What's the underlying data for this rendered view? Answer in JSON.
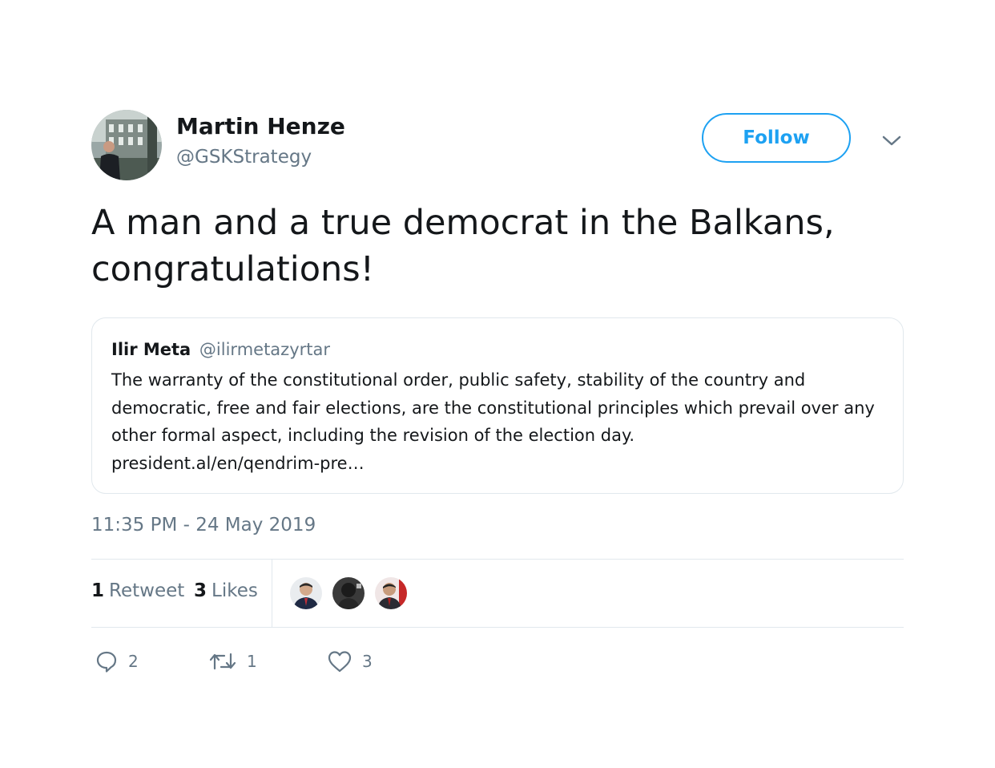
{
  "tweet": {
    "author_name": "Martin Henze",
    "author_handle": "@GSKStrategy",
    "follow_label": "Follow",
    "text": "A man and a true democrat in the Balkans, congratulations!",
    "timestamp": "11:35 PM - 24 May 2019"
  },
  "quoted": {
    "name": "Ilir Meta",
    "handle": "@ilirmetazyrtar",
    "body": "The warranty of the constitutional order, public safety, stability of the country and democratic, free and fair elections, are the constitutional principles which prevail over any other formal aspect, including the revision of the election day.",
    "link": "president.al/en/qendrim-pre…"
  },
  "stats": {
    "retweets_count": "1",
    "retweets_label": "Retweet",
    "likes_count": "3",
    "likes_label": "Likes"
  },
  "actions": {
    "reply_count": "2",
    "retweet_count": "1",
    "like_count": "3"
  },
  "colors": {
    "accent": "#1da1f2",
    "secondary_text": "#657786",
    "border": "#e1e8ed"
  }
}
